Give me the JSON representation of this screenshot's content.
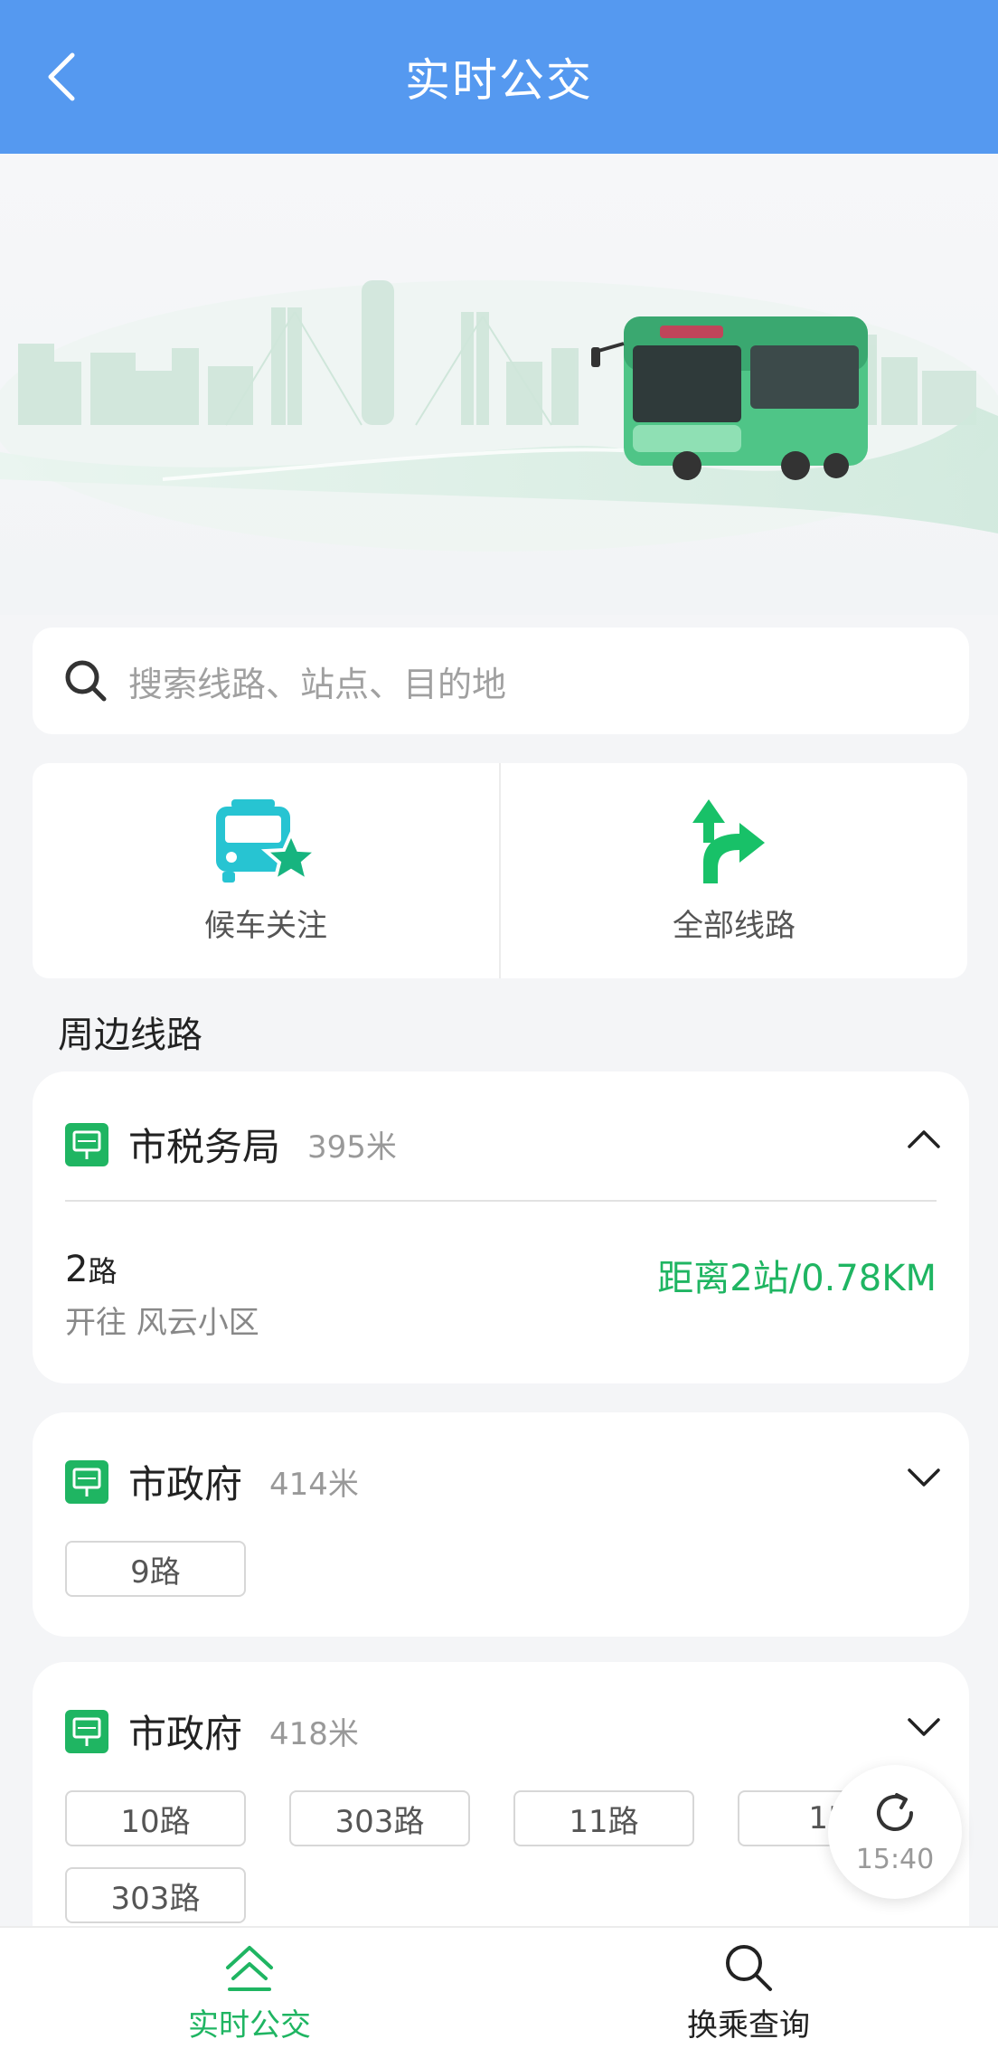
{
  "header": {
    "title": "实时公交"
  },
  "search": {
    "placeholder": "搜索线路、站点、目的地"
  },
  "quick_actions": [
    {
      "label": "候车关注",
      "icon": "bus-star-icon"
    },
    {
      "label": "全部线路",
      "icon": "route-arrow-icon"
    }
  ],
  "section_title": "周边线路",
  "stops": [
    {
      "name": "市税务局",
      "distance": "395米",
      "expanded": true,
      "route": {
        "num": "2",
        "suffix": "路",
        "direction": "开往 风云小区",
        "eta": "距离2站/0.78KM"
      }
    },
    {
      "name": "市政府",
      "distance": "414米",
      "expanded": false,
      "routes": [
        "9路"
      ]
    },
    {
      "name": "市政府",
      "distance": "418米",
      "expanded": false,
      "routes": [
        "10路",
        "303路",
        "11路",
        "15",
        "303路"
      ]
    }
  ],
  "refresh": {
    "time": "15:40"
  },
  "bottom_nav": [
    {
      "label": "实时公交",
      "active": true
    },
    {
      "label": "换乘查询",
      "active": false
    }
  ],
  "colors": {
    "header": "#5599f0",
    "accent_green": "#1fb562",
    "background": "#f4f5f7"
  }
}
